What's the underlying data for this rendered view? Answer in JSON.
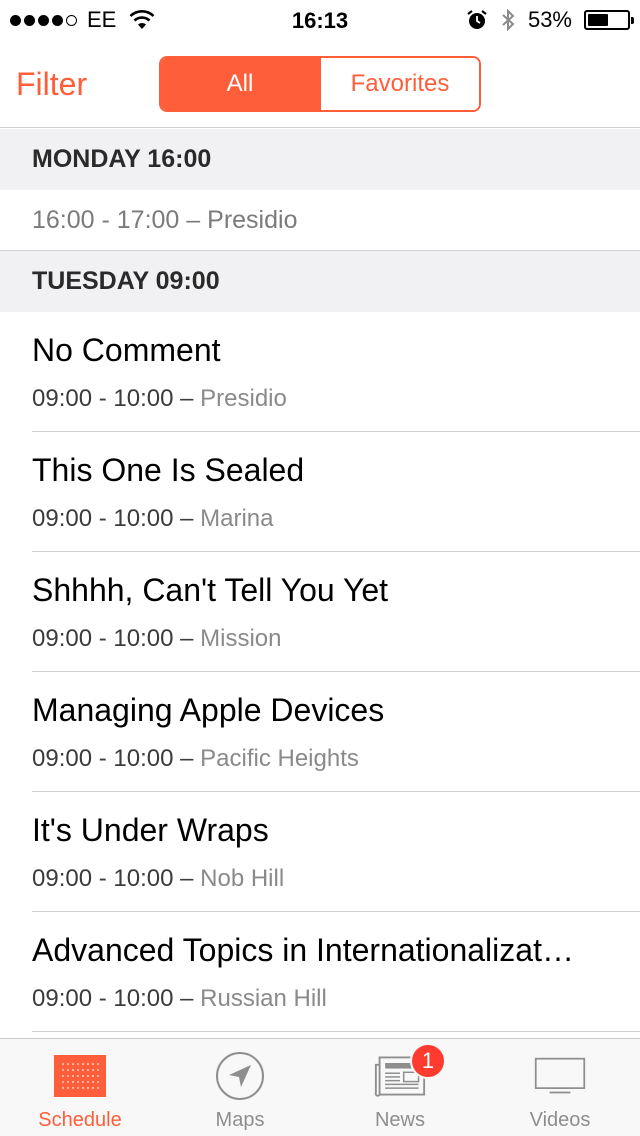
{
  "status_bar": {
    "carrier": "EE",
    "time": "16:13",
    "battery_percent_label": "53%",
    "battery_level": 0.53,
    "signal_bars_filled": 4,
    "signal_bars_total": 5
  },
  "nav": {
    "filter_label": "Filter",
    "segments": [
      {
        "label": "All",
        "selected": true
      },
      {
        "label": "Favorites",
        "selected": false
      }
    ]
  },
  "sections": [
    {
      "header": "MONDAY 16:00",
      "rows": [
        {
          "time": "16:00 - 17:00 –",
          "location": "Presidio"
        }
      ]
    },
    {
      "header": "TUESDAY 09:00",
      "rows": [
        {
          "title": "No Comment",
          "time": "09:00 - 10:00 –",
          "location": "Presidio"
        },
        {
          "title": "This One Is Sealed",
          "time": "09:00 - 10:00 –",
          "location": "Marina"
        },
        {
          "title": "Shhhh, Can't Tell You Yet",
          "time": "09:00 - 10:00 –",
          "location": "Mission"
        },
        {
          "title": "Managing Apple Devices",
          "time": "09:00 - 10:00 –",
          "location": "Pacific Heights"
        },
        {
          "title": "It's Under Wraps",
          "time": "09:00 - 10:00 –",
          "location": "Nob Hill"
        },
        {
          "title": "Advanced Topics in Internationalizat…",
          "time": "09:00 - 10:00 –",
          "location": "Russian Hill"
        }
      ]
    }
  ],
  "tab_bar": {
    "tabs": [
      {
        "label": "Schedule",
        "icon": "calendar-grid-icon",
        "active": true
      },
      {
        "label": "Maps",
        "icon": "location-arrow-icon",
        "active": false
      },
      {
        "label": "News",
        "icon": "newspaper-icon",
        "active": false,
        "badge": "1"
      },
      {
        "label": "Videos",
        "icon": "tv-icon",
        "active": false
      }
    ]
  },
  "colors": {
    "accent": "#ff5e3a",
    "badge": "#ff3b30",
    "section_bg": "#f1f1f3"
  }
}
